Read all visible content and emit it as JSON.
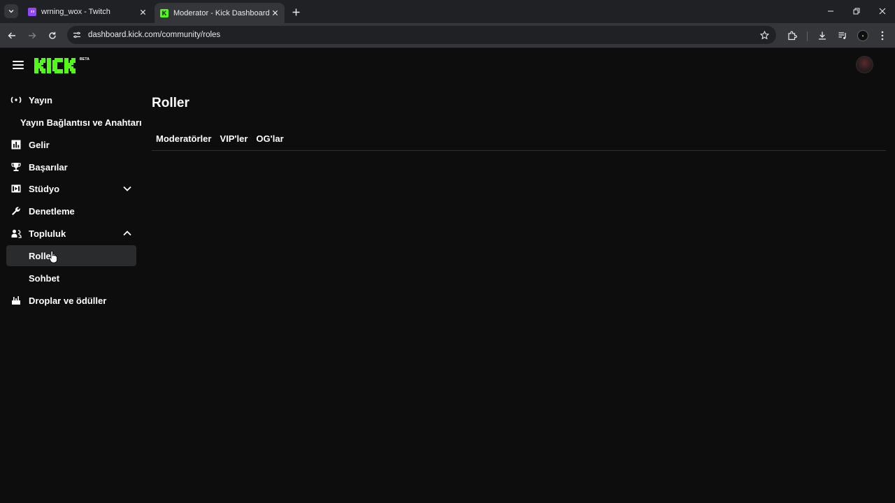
{
  "browser": {
    "tabs": [
      {
        "title": "wrning_wox - Twitch",
        "favicon_color": "#9146ff",
        "active": false
      },
      {
        "title": "Moderator - Kick Dashboard",
        "favicon_color": "#53fc18",
        "active": true
      }
    ],
    "url": "dashboard.kick.com/community/roles"
  },
  "header": {
    "logo_text": "KICK",
    "beta_label": "BETA",
    "brand_color": "#53fc18"
  },
  "sidebar": {
    "items": [
      {
        "label": "Yayın",
        "icon": "broadcast-icon"
      },
      {
        "label": "Yayın Bağlantısı ve Anahtarı"
      },
      {
        "label": "Gelir",
        "icon": "chart-icon"
      },
      {
        "label": "Başarılar",
        "icon": "trophy-icon"
      },
      {
        "label": "Stüdyo",
        "icon": "studio-icon",
        "expanded": false
      },
      {
        "label": "Denetleme",
        "icon": "wrench-icon"
      },
      {
        "label": "Topluluk",
        "icon": "community-icon",
        "expanded": true
      },
      {
        "label": "Roller",
        "selected": true
      },
      {
        "label": "Sohbet"
      },
      {
        "label": "Droplar ve ödüller",
        "icon": "drops-icon"
      }
    ]
  },
  "main": {
    "title": "Roller",
    "tabs": [
      "Moderatörler",
      "VIP'ler",
      "OG'lar"
    ]
  }
}
